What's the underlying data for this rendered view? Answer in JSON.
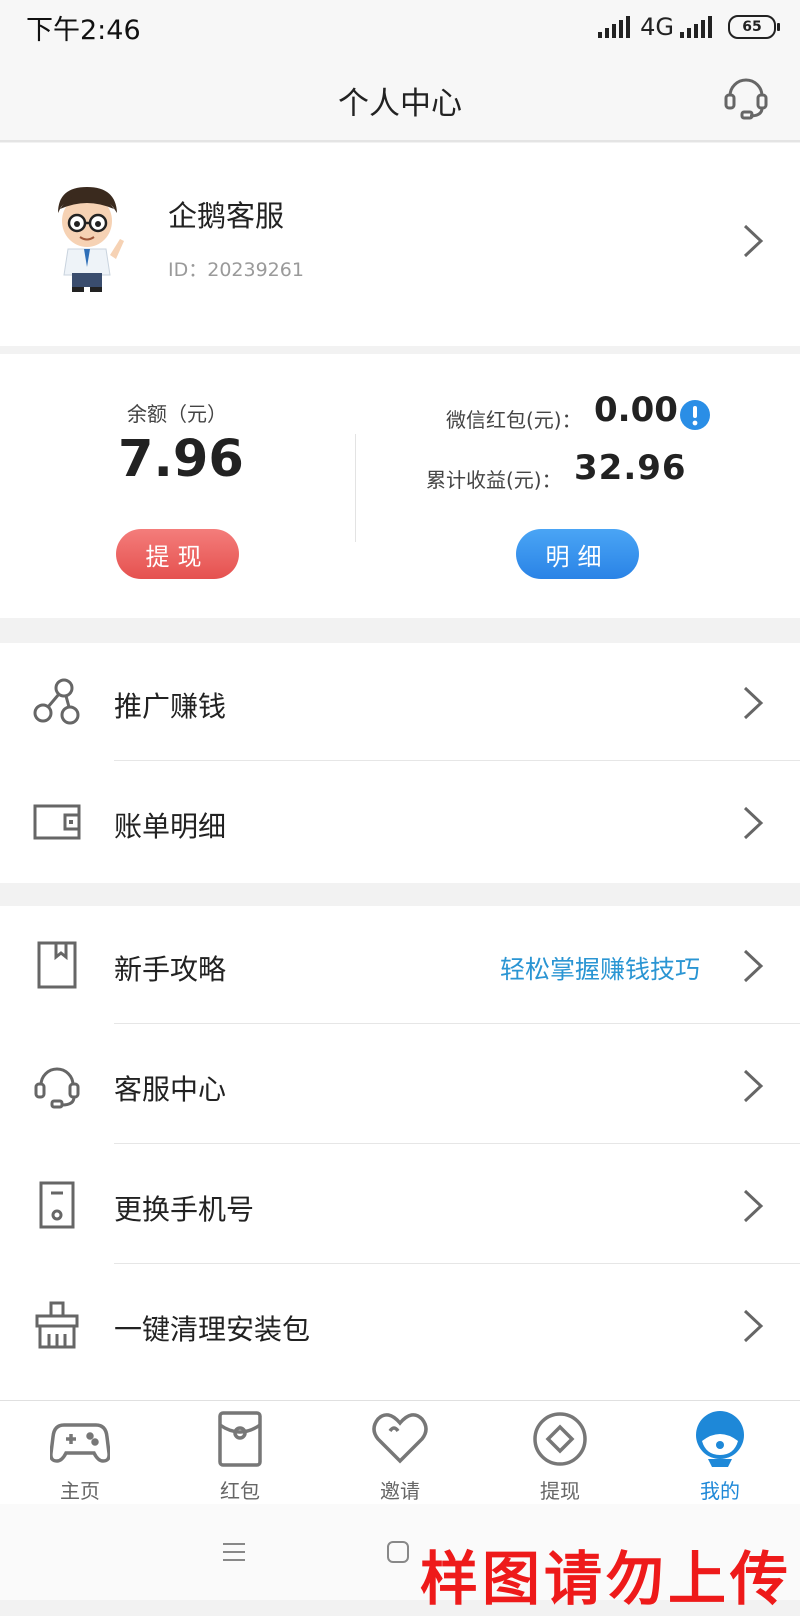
{
  "status_bar": {
    "time": "下午2:46",
    "network": "4G",
    "battery": "65"
  },
  "header": {
    "title": "个人中心",
    "support_icon": "headset-icon"
  },
  "profile": {
    "name": "企鹅客服",
    "id_text": "ID：20239261"
  },
  "balance": {
    "label": "余额（元）",
    "value": "7.96",
    "withdraw_button": "提现",
    "wechat_label": "微信红包(元)：",
    "wechat_value": "0.00",
    "cumulative_label": "累计收益(元)：",
    "cumulative_value": "32.96",
    "detail_button": "明细"
  },
  "menu_group_1": [
    {
      "label": "推广赚钱",
      "icon": "share-icon"
    },
    {
      "label": "账单明细",
      "icon": "wallet-icon"
    }
  ],
  "menu_group_2": [
    {
      "label": "新手攻略",
      "icon": "bookmark-icon",
      "hint": "轻松掌握赚钱技巧"
    },
    {
      "label": "客服中心",
      "icon": "headset-icon"
    },
    {
      "label": "更换手机号",
      "icon": "phone-icon"
    },
    {
      "label": "一键清理安装包",
      "icon": "broom-icon"
    }
  ],
  "tabs": [
    {
      "label": "主页",
      "icon": "gamepad-icon"
    },
    {
      "label": "红包",
      "icon": "red-packet-icon"
    },
    {
      "label": "邀请",
      "icon": "heart-icon"
    },
    {
      "label": "提现",
      "icon": "coin-icon"
    },
    {
      "label": "我的",
      "icon": "profile-icon",
      "active": true
    }
  ],
  "watermark": "样图请勿上传",
  "colors": {
    "accent_blue": "#1e88d8",
    "withdraw_red": "#e5514f",
    "detail_blue": "#2a83e6",
    "hint_blue": "#2a95d3"
  }
}
